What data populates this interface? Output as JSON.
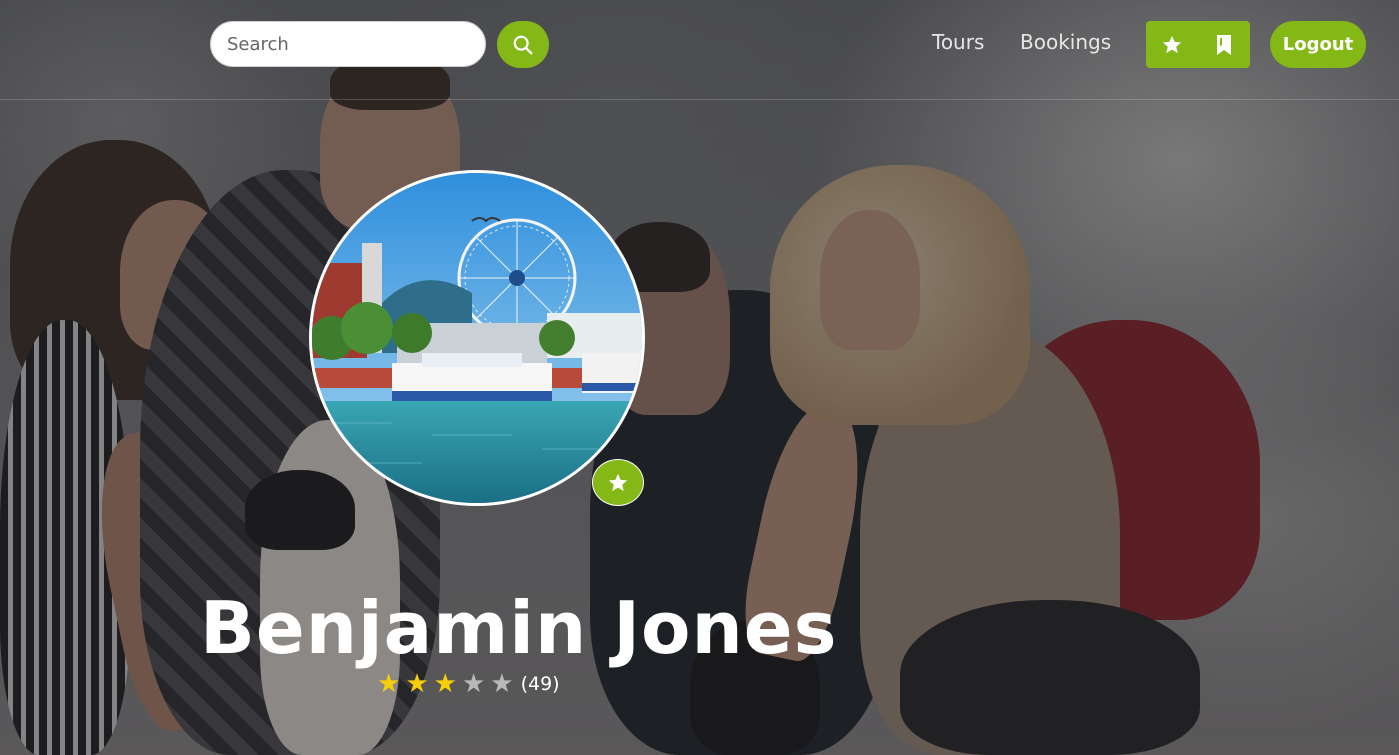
{
  "header": {
    "search": {
      "placeholder": "Search",
      "value": ""
    },
    "search_button_icon": "search-icon",
    "nav": [
      {
        "label": "Tours"
      },
      {
        "label": "Bookings"
      }
    ],
    "icon_buttons": [
      {
        "icon": "star-icon"
      },
      {
        "icon": "bookmark-icon"
      }
    ],
    "logout_label": "Logout"
  },
  "profile": {
    "name": "Benjamin Jones",
    "favorite_badge_icon": "star-icon",
    "rating": {
      "stars_filled": 3,
      "stars_total": 5,
      "count_label": "(49)"
    }
  },
  "colors": {
    "accent": "#84b817",
    "star_filled": "#f6cf0a",
    "star_empty": "#b9b9b9",
    "text_light": "#ffffff"
  }
}
